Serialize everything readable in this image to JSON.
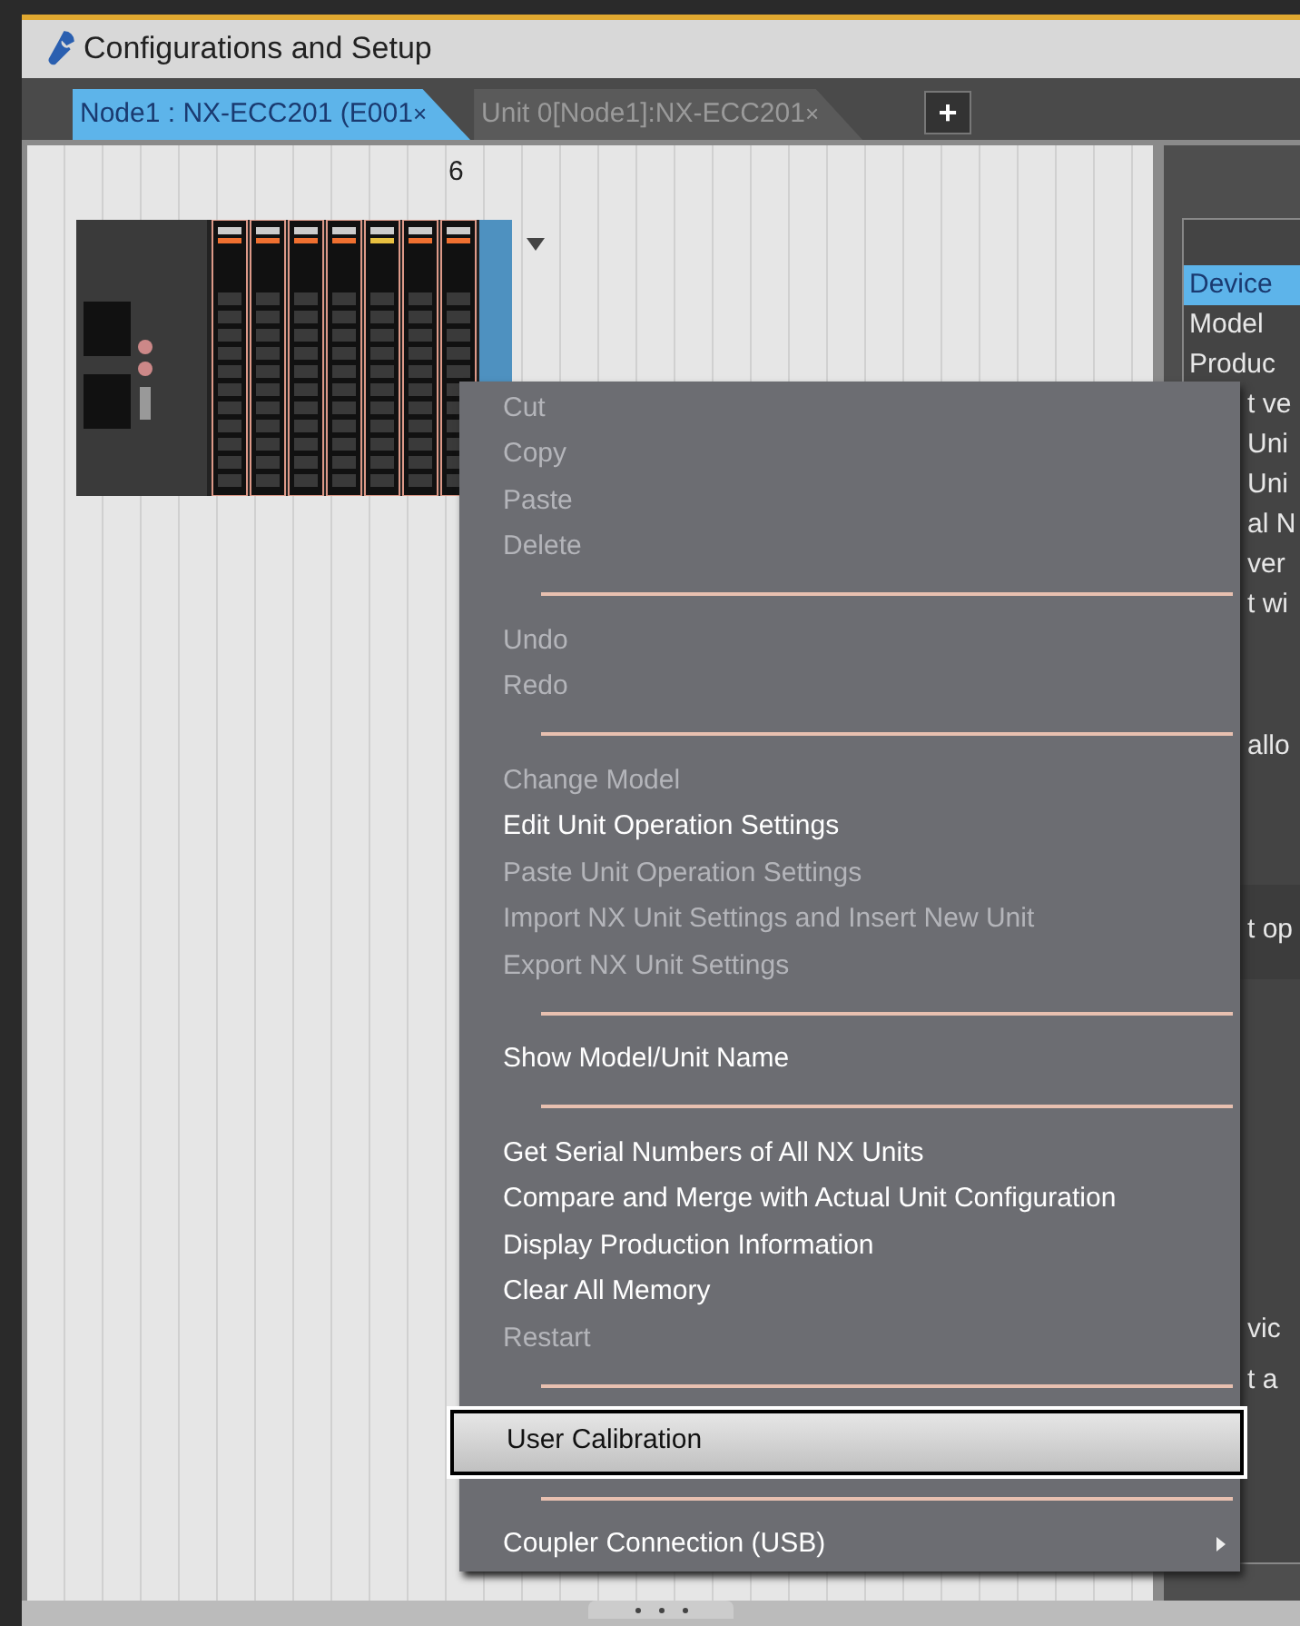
{
  "window": {
    "title": "Configurations and Setup"
  },
  "tabs": [
    {
      "label": "Node1 : NX-ECC201 (E001",
      "close": "×",
      "selected": true
    },
    {
      "label": "Unit 0[Node1]:NX-ECC201",
      "close": "×",
      "selected": false
    }
  ],
  "add_tab": "+",
  "canvas": {
    "slot_number": "6"
  },
  "side_panel": {
    "list": [
      {
        "text": "Device",
        "selected": true,
        "kind": "full"
      },
      {
        "text": "Model",
        "selected": false,
        "kind": "full"
      },
      {
        "text": "Produc",
        "selected": false,
        "kind": "full"
      },
      {
        "text": "t ve",
        "selected": false,
        "kind": "clipped"
      },
      {
        "text": "Uni",
        "selected": false,
        "kind": "clipped"
      },
      {
        "text": "Uni",
        "selected": false,
        "kind": "clipped"
      },
      {
        "text": "al N",
        "selected": false,
        "kind": "clipped"
      },
      {
        "text": "ver",
        "selected": false,
        "kind": "clipped"
      },
      {
        "text": "t wi",
        "selected": false,
        "kind": "clipped"
      }
    ],
    "note": "allo",
    "band": "t op",
    "footer": [
      "vic",
      "t a"
    ]
  },
  "context_menu": [
    {
      "kind": "item",
      "label": "Cut",
      "disabled": true,
      "selected": false
    },
    {
      "kind": "item",
      "label": "Copy",
      "disabled": true,
      "selected": false
    },
    {
      "kind": "item",
      "label": "Paste",
      "disabled": true,
      "selected": false
    },
    {
      "kind": "item",
      "label": "Delete",
      "disabled": true,
      "selected": false
    },
    {
      "kind": "separator"
    },
    {
      "kind": "item",
      "label": "Undo",
      "disabled": true,
      "selected": false
    },
    {
      "kind": "item",
      "label": "Redo",
      "disabled": true,
      "selected": false
    },
    {
      "kind": "separator"
    },
    {
      "kind": "item",
      "label": "Change Model",
      "disabled": true,
      "selected": false
    },
    {
      "kind": "item",
      "label": "Edit Unit Operation Settings",
      "disabled": false,
      "selected": false
    },
    {
      "kind": "item",
      "label": "Paste Unit Operation Settings",
      "disabled": true,
      "selected": false
    },
    {
      "kind": "item",
      "label": "Import NX Unit Settings and Insert New Unit",
      "disabled": true,
      "selected": false
    },
    {
      "kind": "item",
      "label": "Export NX Unit Settings",
      "disabled": true,
      "selected": false
    },
    {
      "kind": "separator"
    },
    {
      "kind": "item",
      "label": "Show Model/Unit Name",
      "disabled": false,
      "selected": false
    },
    {
      "kind": "separator"
    },
    {
      "kind": "item",
      "label": "Get Serial Numbers of All NX Units",
      "disabled": false,
      "selected": false
    },
    {
      "kind": "item",
      "label": "Compare and Merge with Actual Unit Configuration",
      "disabled": false,
      "selected": false
    },
    {
      "kind": "item",
      "label": "Display Production Information",
      "disabled": false,
      "selected": false
    },
    {
      "kind": "item",
      "label": "Clear All Memory",
      "disabled": false,
      "selected": false
    },
    {
      "kind": "item",
      "label": "Restart",
      "disabled": true,
      "selected": false
    },
    {
      "kind": "separator"
    },
    {
      "kind": "item",
      "label": "User Calibration",
      "disabled": false,
      "selected": true
    },
    {
      "kind": "separator"
    },
    {
      "kind": "submenu",
      "label": "Coupler Connection (USB)",
      "disabled": false,
      "selected": false
    }
  ]
}
